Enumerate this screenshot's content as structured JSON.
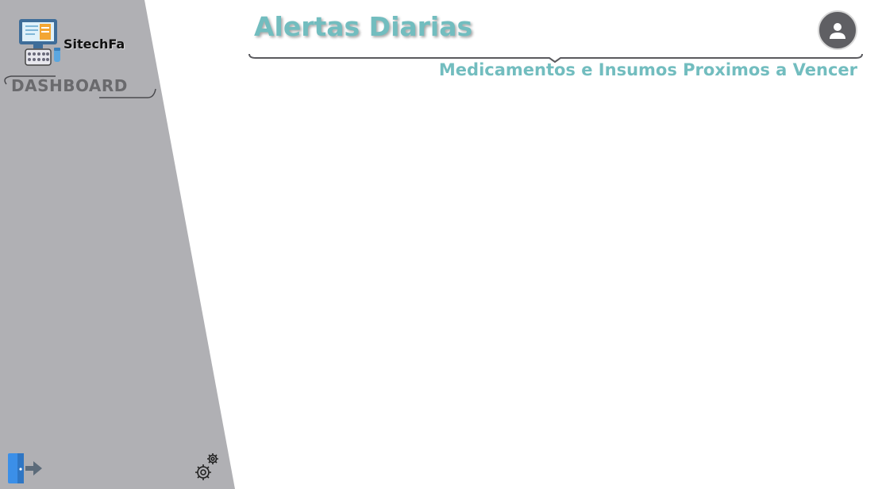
{
  "sidebar": {
    "brand": "SitechFa",
    "dashboard_label": "DASHBOARD",
    "logo_icon": "pharmacy-computer-icon",
    "logout_icon": "logout-door-icon",
    "settings_icon": "gears-icon",
    "background_color": "#b0b0b4"
  },
  "header": {
    "title": "Alertas Diarias",
    "subtitle": "Medicamentos e Insumos Proximos a Vencer",
    "accent_color": "#72bdbf",
    "avatar_icon": "user-avatar-icon"
  }
}
